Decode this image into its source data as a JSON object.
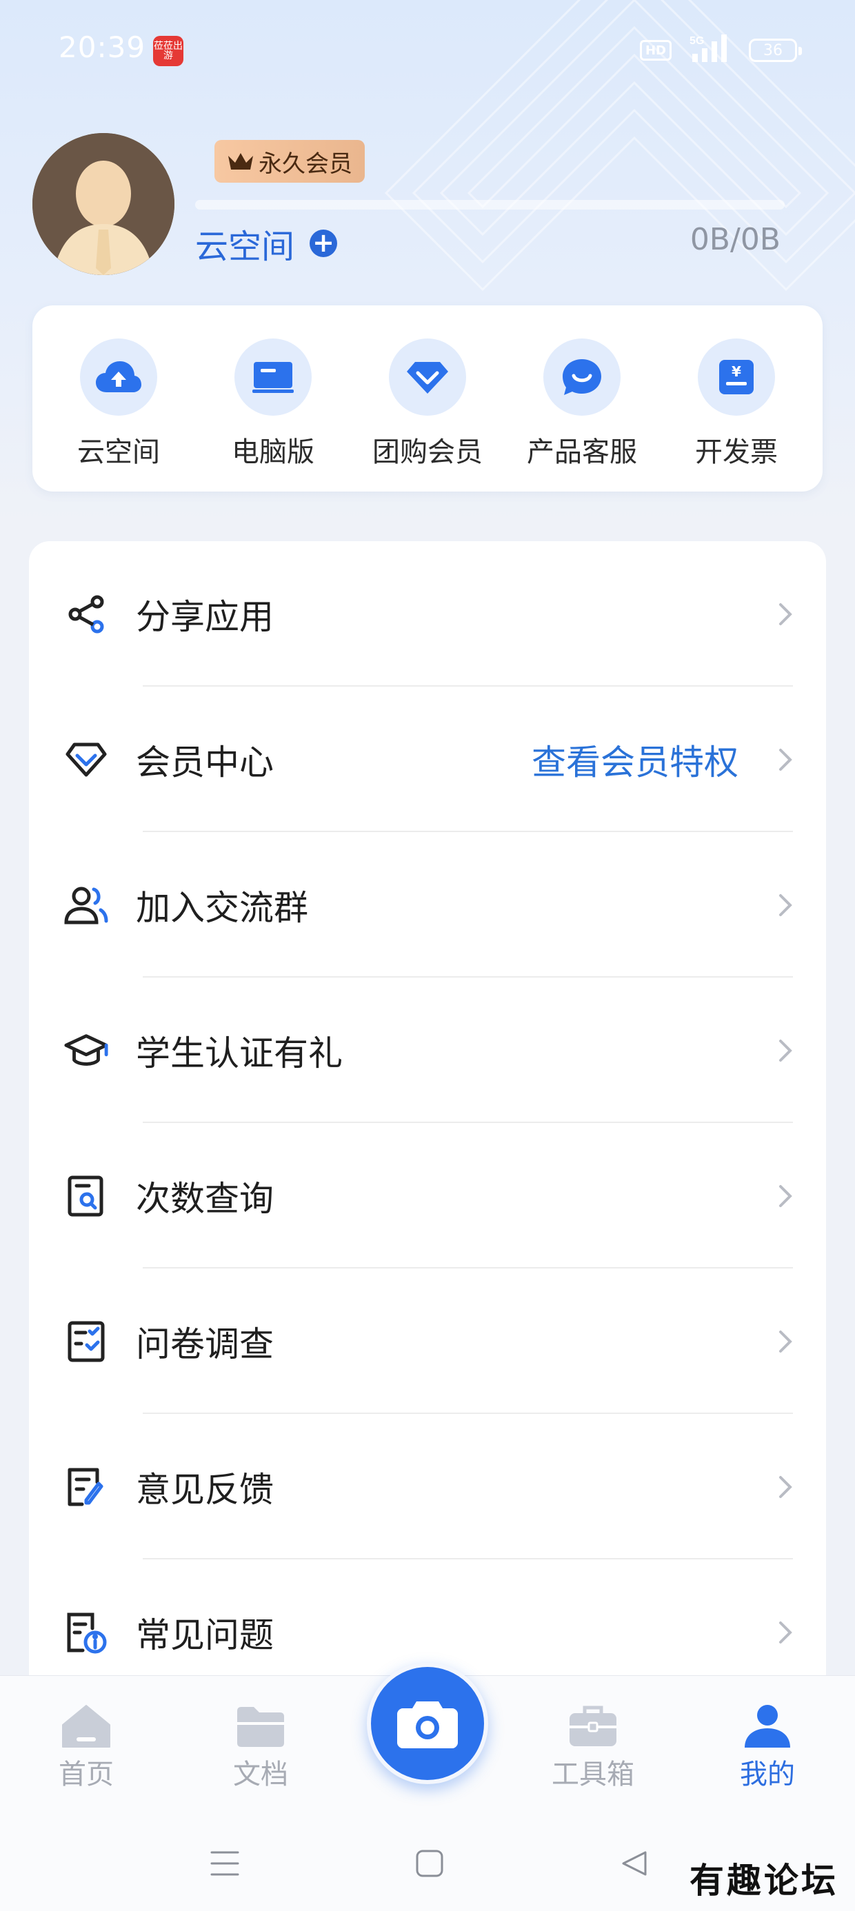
{
  "status_bar": {
    "time": "20:39",
    "app_icon_text": "莅莅出游",
    "hd_label": "HD",
    "signal_label": "5G",
    "battery": "36"
  },
  "profile": {
    "member_badge": "永久会员",
    "space_title": "云空间",
    "space_usage": "0B/0B"
  },
  "quick_actions": [
    {
      "label": "云空间",
      "icon": "cloud-upload-icon"
    },
    {
      "label": "电脑版",
      "icon": "monitor-icon"
    },
    {
      "label": "团购会员",
      "icon": "diamond-icon"
    },
    {
      "label": "产品客服",
      "icon": "chat-smile-icon"
    },
    {
      "label": "开发票",
      "icon": "invoice-icon"
    }
  ],
  "menu": [
    {
      "label": "分享应用",
      "icon": "share-icon",
      "extra": ""
    },
    {
      "label": "会员中心",
      "icon": "diamond-icon",
      "extra": "查看会员特权"
    },
    {
      "label": "加入交流群",
      "icon": "group-icon",
      "extra": ""
    },
    {
      "label": "学生认证有礼",
      "icon": "graduation-cap-icon",
      "extra": ""
    },
    {
      "label": "次数查询",
      "icon": "search-document-icon",
      "extra": ""
    },
    {
      "label": "问卷调查",
      "icon": "checklist-icon",
      "extra": ""
    },
    {
      "label": "意见反馈",
      "icon": "edit-document-icon",
      "extra": ""
    },
    {
      "label": "常见问题",
      "icon": "info-document-icon",
      "extra": ""
    }
  ],
  "bottom_nav": [
    {
      "label": "首页",
      "icon": "home-icon",
      "active": false
    },
    {
      "label": "文档",
      "icon": "folder-icon",
      "active": false
    },
    {
      "label": "工具箱",
      "icon": "toolbox-icon",
      "active": false
    },
    {
      "label": "我的",
      "icon": "person-icon",
      "active": true
    }
  ],
  "camera_button": {
    "icon": "camera-icon"
  },
  "system_nav": [
    {
      "icon": "menu-icon"
    },
    {
      "icon": "home-square-icon"
    },
    {
      "icon": "back-triangle-icon"
    }
  ],
  "watermark": "有趣论坛",
  "colors": {
    "accent": "#2c72ec",
    "link": "#2a72d8",
    "badge_gold": "#eab68e",
    "background": "#eff2f8"
  }
}
